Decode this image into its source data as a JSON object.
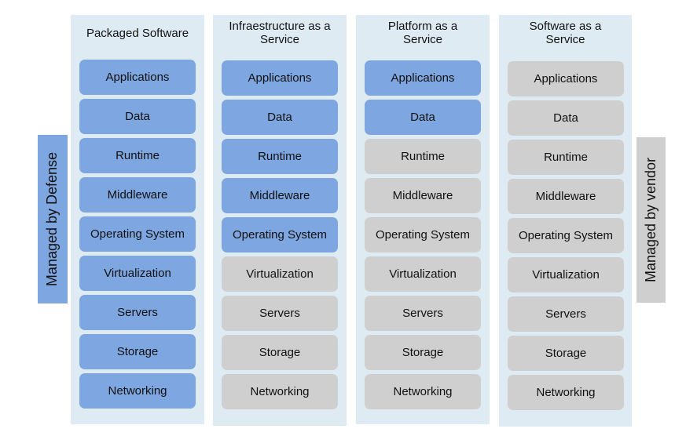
{
  "colors": {
    "managed_by_defense": "#7ea6e0",
    "managed_by_vendor": "#cfcfcf",
    "column_bg": "#deebf3"
  },
  "labels": {
    "left": "Managed by Defense",
    "right": "Managed by vendor"
  },
  "columns": [
    {
      "title": "Packaged Software",
      "defense_count": 9
    },
    {
      "title": "Infraestructure as a Service",
      "defense_count": 5
    },
    {
      "title": "Platform as a Service",
      "defense_count": 2
    },
    {
      "title": "Software as a Service",
      "defense_count": 0
    }
  ],
  "layers": [
    "Applications",
    "Data",
    "Runtime",
    "Middleware",
    "Operating System",
    "Virtualization",
    "Servers",
    "Storage",
    "Networking"
  ]
}
